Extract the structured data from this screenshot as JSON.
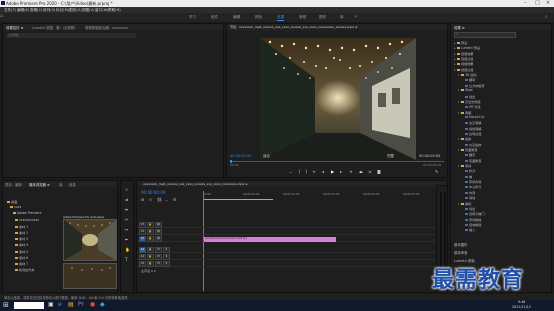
{
  "title": "Adobe Premiere Pro 2020 - C:\\用户\\Video\\最新.prproj *",
  "menu": [
    "文件(F)",
    "编辑(E)",
    "剪辑(C)",
    "序列(S)",
    "标记(M)",
    "图形(G)",
    "视图(V)",
    "窗口(W)",
    "帮助(H)"
  ],
  "workspaces": [
    "学习",
    "组件",
    "编辑",
    "颜色",
    "效果",
    "音频",
    "图形",
    "库"
  ],
  "active_workspace": "效果",
  "source_panel": {
    "tabs": [
      "效果控件 ≡",
      "Lumetri 范围",
      "源：(无剪辑)",
      "音频剪辑混合器：xxxxxxxx"
    ],
    "search_placeholder": "(无剪辑)"
  },
  "program_panel": {
    "tab": "节目：xxxxxxxx_mp4_xxxxxx_xxx_xxxx_xxxxxx_xxx_xxxx_xxxxxxxxx_xxxxxx.mp4 ≡",
    "timecode_left": "00:00:00:00",
    "timecode_right": "00:00:05:00",
    "fit": "适合",
    "resolution": "完整",
    "ruler_left": "00:00",
    "ruler_right": "00:00:05:00"
  },
  "effects_panel": {
    "tab": "效果 ≡",
    "items": [
      {
        "label": "预设",
        "level": 0,
        "folder": true
      },
      {
        "label": "Lumetri 预设",
        "level": 0,
        "folder": true
      },
      {
        "label": "音频效果",
        "level": 0,
        "folder": true
      },
      {
        "label": "音频过渡",
        "level": 0,
        "folder": true
      },
      {
        "label": "视频效果",
        "level": 0,
        "folder": true
      },
      {
        "label": "视频过渡",
        "level": 0,
        "folder": true,
        "open": true
      },
      {
        "label": "3D 运动",
        "level": 1,
        "folder": true
      },
      {
        "label": "翻转",
        "level": 2,
        "folder": false
      },
      {
        "label": "立方体旋转",
        "level": 2,
        "folder": false
      },
      {
        "label": "Wipe",
        "level": 1,
        "folder": true
      },
      {
        "label": "划出",
        "level": 2,
        "folder": false
      },
      {
        "label": "沉浸式视频",
        "level": 1,
        "folder": true
      },
      {
        "label": "VR 光线",
        "level": 2,
        "folder": false
      },
      {
        "label": "溶解",
        "level": 1,
        "folder": true
      },
      {
        "label": "MorphCut",
        "level": 2,
        "folder": false
      },
      {
        "label": "交叉溶解",
        "level": 2,
        "folder": false
      },
      {
        "label": "叠加溶解",
        "level": 2,
        "folder": false
      },
      {
        "label": "白场过渡",
        "level": 2,
        "folder": false
      },
      {
        "label": "缩放",
        "level": 1,
        "folder": true
      },
      {
        "label": "交叉缩放",
        "level": 2,
        "folder": false
      },
      {
        "label": "页面剥落",
        "level": 1,
        "folder": true
      },
      {
        "label": "翻页",
        "level": 2,
        "folder": false
      },
      {
        "label": "页面剥落",
        "level": 2,
        "folder": false
      },
      {
        "label": "滑动",
        "level": 1,
        "folder": true
      },
      {
        "label": "拆分",
        "level": 2,
        "folder": false
      },
      {
        "label": "推",
        "level": 2,
        "folder": false
      },
      {
        "label": "带状内滑",
        "level": 2,
        "folder": false
      },
      {
        "label": "中心拆分",
        "level": 2,
        "folder": false
      },
      {
        "label": "内滑",
        "level": 2,
        "folder": false
      },
      {
        "label": "滑动",
        "level": 2,
        "folder": false
      },
      {
        "label": "擦除",
        "level": 1,
        "folder": true
      },
      {
        "label": "划出",
        "level": 2,
        "folder": false
      },
      {
        "label": "双侧平推门",
        "level": 2,
        "folder": false
      },
      {
        "label": "带状擦除",
        "level": 2,
        "folder": false
      },
      {
        "label": "径向擦除",
        "level": 2,
        "folder": false
      },
      {
        "label": "插入",
        "level": 2,
        "folder": false
      }
    ],
    "bottom_items": [
      "基本图形",
      "基本声音",
      "Lumetri 颜色",
      "库"
    ]
  },
  "project_panel": {
    "tabs": [
      "项目：最新",
      "媒体浏览器 ≡",
      "库",
      "信息"
    ],
    "folders": [
      "桌面",
      "xxxx",
      "Adobe Premiere",
      "xxxxxxxxxxx",
      "素材 1",
      "素材 2",
      "素材 3",
      "素材 4",
      "素材 5",
      "素材 6",
      "素材 7",
      "新建文件夹"
    ],
    "clip_label": "Adobe Premiere Pro Auto-Save"
  },
  "timeline": {
    "tab": "xxxxxxxx_mp4_xxxxxx_xxx_xxxx_xxxxxx_xxx_xxxx_xxxxxxxx.mp4 ≡",
    "timecode": "00:00:00:00",
    "ruler": [
      "00:00",
      "00:00:05:00",
      "00:00:10:00",
      "00:00:15:00",
      "00:00:20:00",
      "00:00:25:00"
    ],
    "video_tracks": [
      "V3",
      "V2",
      "V1"
    ],
    "audio_tracks": [
      "A1",
      "A2",
      "A3"
    ],
    "mix_label": "主声道",
    "mix_value": "0.0",
    "clip_name": "xxxxxxxxxxxxxxxxxxxx.mp4 [V]"
  },
  "statusbar": "单击以选择，或单击空白处并拖动以进行框选。使用 Shift、Alt 和 Ctrl 可获得其他选项。",
  "taskbar": {
    "time": "9:46",
    "date": "2021/11/12"
  },
  "watermark": "最需教育",
  "colors": {
    "accent": "#2d8ceb",
    "clip": "#d87fd8",
    "folder": "#d9a441"
  }
}
